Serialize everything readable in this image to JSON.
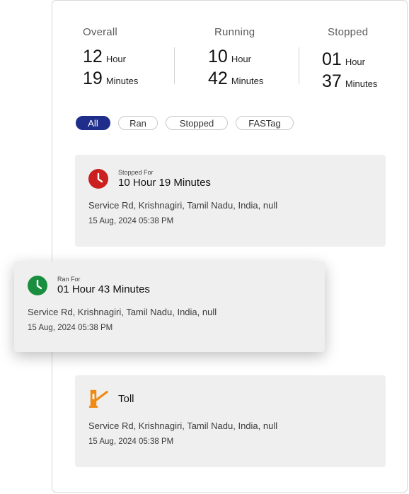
{
  "summary": {
    "overall": {
      "title": "Overall",
      "hours": "12",
      "hour_unit": "Hour",
      "minutes": "19",
      "minute_unit": "Minutes"
    },
    "running": {
      "title": "Running",
      "hours": "10",
      "hour_unit": "Hour",
      "minutes": "42",
      "minute_unit": "Minutes"
    },
    "stopped": {
      "title": "Stopped",
      "hours": "01",
      "hour_unit": "Hour",
      "minutes": "37",
      "minute_unit": "Minutes"
    }
  },
  "filters": [
    "All",
    "Ran",
    "Stopped",
    "FASTag"
  ],
  "active_filter": "All",
  "events": [
    {
      "kind": "stopped",
      "icon": "clock-icon",
      "icon_color": "#cc1f1f",
      "caption": "Stopped For",
      "title": "10 Hour 19 Minutes",
      "address": "Service Rd, Krishnagiri, Tamil Nadu, India, null",
      "time": "15 Aug, 2024 05:38 PM"
    },
    {
      "kind": "ran",
      "icon": "clock-icon",
      "icon_color": "#1a8e3f",
      "caption": "Ran For",
      "title": "01 Hour 43 Minutes",
      "address": "Service Rd, Krishnagiri, Tamil Nadu, India, null",
      "time": "15 Aug, 2024 05:38 PM"
    },
    {
      "kind": "toll",
      "icon": "toll-gate-icon",
      "icon_color": "#f08a12",
      "caption": "",
      "title": "Toll",
      "address": "Service Rd, Krishnagiri, Tamil Nadu, India, null",
      "time": "15 Aug, 2024 05:38 PM"
    }
  ],
  "colors": {
    "accent": "#1f2e8a",
    "card_bg": "#efefef"
  }
}
